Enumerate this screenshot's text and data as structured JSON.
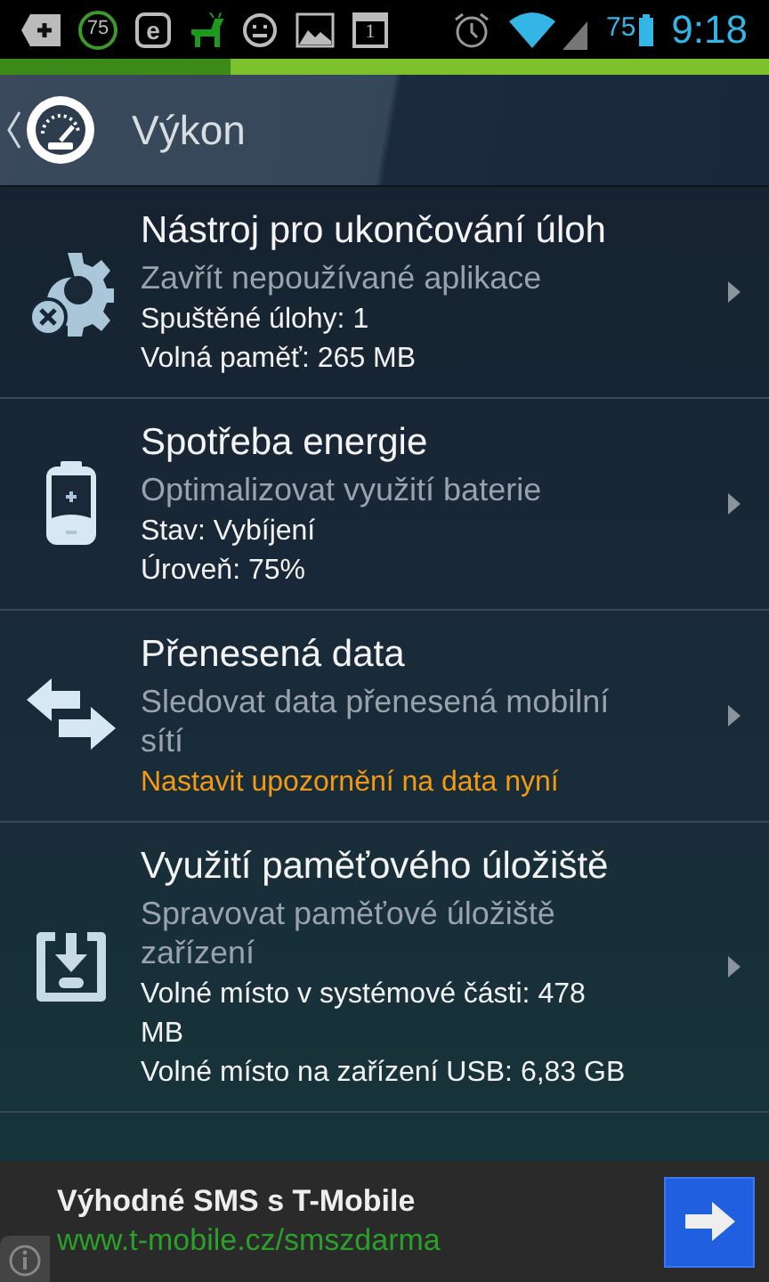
{
  "status_bar": {
    "level_badge": "75",
    "e_icon_letter": "e",
    "calendar_day": "1",
    "battery_percent": "75",
    "time": "9:18"
  },
  "header": {
    "title": "Výkon"
  },
  "items": [
    {
      "kind": "tasks",
      "title": "Nástroj pro ukončování úloh",
      "subtitle": "Zavřít nepoužívané aplikace",
      "details": [
        {
          "text": "Spuštěné úlohy: 1",
          "kind": "info"
        },
        {
          "text": "Volná paměť: 265 MB",
          "kind": "info"
        }
      ]
    },
    {
      "kind": "battery",
      "title": "Spotřeba energie",
      "subtitle": "Optimalizovat využití baterie",
      "details": [
        {
          "text": "Stav: Vybíjení",
          "kind": "info"
        },
        {
          "text": "Úroveň: 75%",
          "kind": "info"
        }
      ]
    },
    {
      "kind": "data",
      "title": "Přenesená data",
      "subtitle": "Sledovat data přenesená mobilní sítí",
      "details": [
        {
          "text": "Nastavit upozornění na data nyní",
          "kind": "alert"
        }
      ]
    },
    {
      "kind": "storage",
      "title": "Využití paměťového úložiště",
      "subtitle": "Spravovat paměťové úložiště zařízení",
      "details": [
        {
          "text": "Volné místo v systémové části: 478 MB",
          "kind": "info"
        },
        {
          "text": "Volné místo na zařízení USB: 6,83 GB",
          "kind": "info"
        }
      ]
    }
  ],
  "ad": {
    "title": "Výhodné SMS s T-Mobile",
    "url": "www.t-mobile.cz/smszdarma"
  }
}
